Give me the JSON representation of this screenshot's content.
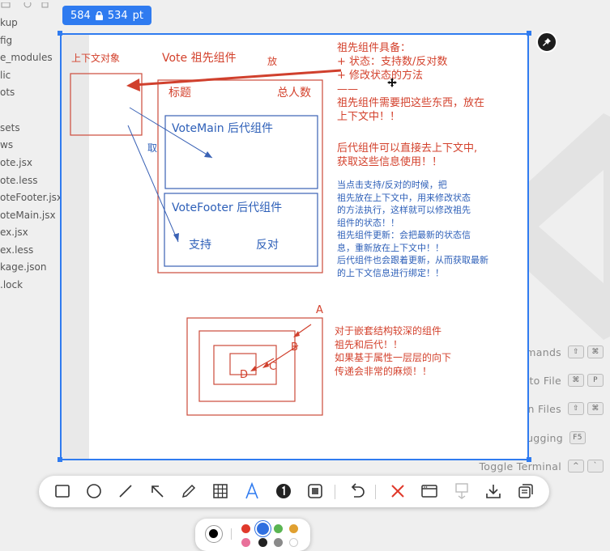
{
  "size_tag": {
    "width": "584",
    "height": "534",
    "unit": "pt"
  },
  "sidebar_files": [
    "kup",
    "fig",
    "e_modules",
    "lic",
    "ots",
    "sets",
    "ws",
    "ote.jsx",
    "ote.less",
    "oteFooter.jsx",
    "oteMain.jsx",
    "ex.jsx",
    "ex.less",
    "kage.json",
    ".lock"
  ],
  "commands": [
    {
      "label": "Show All Commands",
      "keys": [
        "⇧",
        "⌘"
      ]
    },
    {
      "label": "Go to File",
      "keys": [
        "⌘",
        "P"
      ]
    },
    {
      "label": "Find in Files",
      "keys": [
        "⇧",
        "⌘"
      ]
    },
    {
      "label": "Start Debugging",
      "keys": [
        "F5"
      ]
    },
    {
      "label": "Toggle Terminal",
      "keys": [
        "^",
        "`"
      ]
    }
  ],
  "drawing": {
    "context_label": "上下文对象",
    "vote_title": "Vote 祖先组件",
    "fang": "放",
    "qu": "取",
    "biaoti": "标题",
    "total": "总人数",
    "votemain": "VoteMain 后代组件",
    "votefooter": "VoteFooter 后代组件",
    "support": "支持",
    "oppose": "反对",
    "letters": {
      "a": "A",
      "b": "B",
      "c": "C",
      "d": "D"
    },
    "notes1": [
      "祖先组件具备：",
      "+ 状态：支持数/反对数",
      "+ 修改状态的方法",
      "——",
      "祖先组件需要把这些东西，放在",
      "上下文中！！"
    ],
    "notes2": [
      "后代组件可以直接去上下文中,",
      "获取这些信息使用！！"
    ],
    "notes3": [
      "当点击支持/反对的时候，把",
      "祖先放在上下文中，用来修改状态",
      "的方法执行，这样就可以修改祖先",
      "组件的状态！！",
      "祖先组件更新：会把最新的状态信",
      "息，重新放在上下文中！！",
      "后代组件也会跟着更新，从而获取最新",
      "的上下文信息进行绑定！！"
    ],
    "notes4": [
      "对于嵌套结构较深的组件",
      "祖先和后代！！",
      "如果基于属性一层层的向下",
      "传递会非常的麻烦！！"
    ]
  },
  "toolbar_tools": [
    "rectangle",
    "ellipse",
    "line",
    "arrow",
    "pen",
    "mosaic",
    "text",
    "counter",
    "highlight",
    "undo",
    "cancel",
    "window",
    "pin-to-screen",
    "save",
    "copy"
  ],
  "palette": {
    "selected": "#000000",
    "colors": [
      "#e0392b",
      "#2f6fe0",
      "#5ab552",
      "#e0a030",
      "#e9709a",
      "#222222",
      "#8a8a8a",
      "#ffffff"
    ]
  }
}
